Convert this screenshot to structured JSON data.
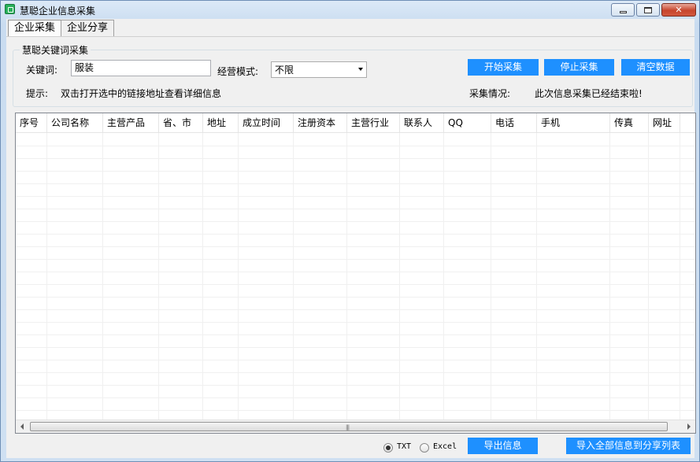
{
  "window": {
    "title": "慧聪企业信息采集"
  },
  "tabs": [
    {
      "label": "企业采集",
      "active": true
    },
    {
      "label": "企业分享",
      "active": false
    }
  ],
  "group": {
    "legend": "慧聪关键词采集",
    "keyword_label": "关键词:",
    "keyword_value": "服装",
    "mode_label": "经营模式:",
    "mode_value": "不限",
    "hint_label": "提示:",
    "hint_text": "双击打开选中的链接地址查看详细信息",
    "status_label": "采集情况:",
    "status_text": "此次信息采集已经结束啦!",
    "buttons": {
      "start": "开始采集",
      "stop": "停止采集",
      "clear": "清空数据"
    }
  },
  "table": {
    "columns": [
      "序号",
      "公司名称",
      "主营产品",
      "省、市",
      "地址",
      "成立时间",
      "注册资本",
      "主营行业",
      "联系人",
      "QQ",
      "电话",
      "手机",
      "传真",
      "网址"
    ]
  },
  "bottom": {
    "radio_txt": "TXT",
    "radio_excel": "Excel",
    "selected_format": "TXT",
    "export_button": "导出信息",
    "import_all_button": "导入全部信息到分享列表"
  },
  "colors": {
    "button_blue": "#1e90ff"
  }
}
